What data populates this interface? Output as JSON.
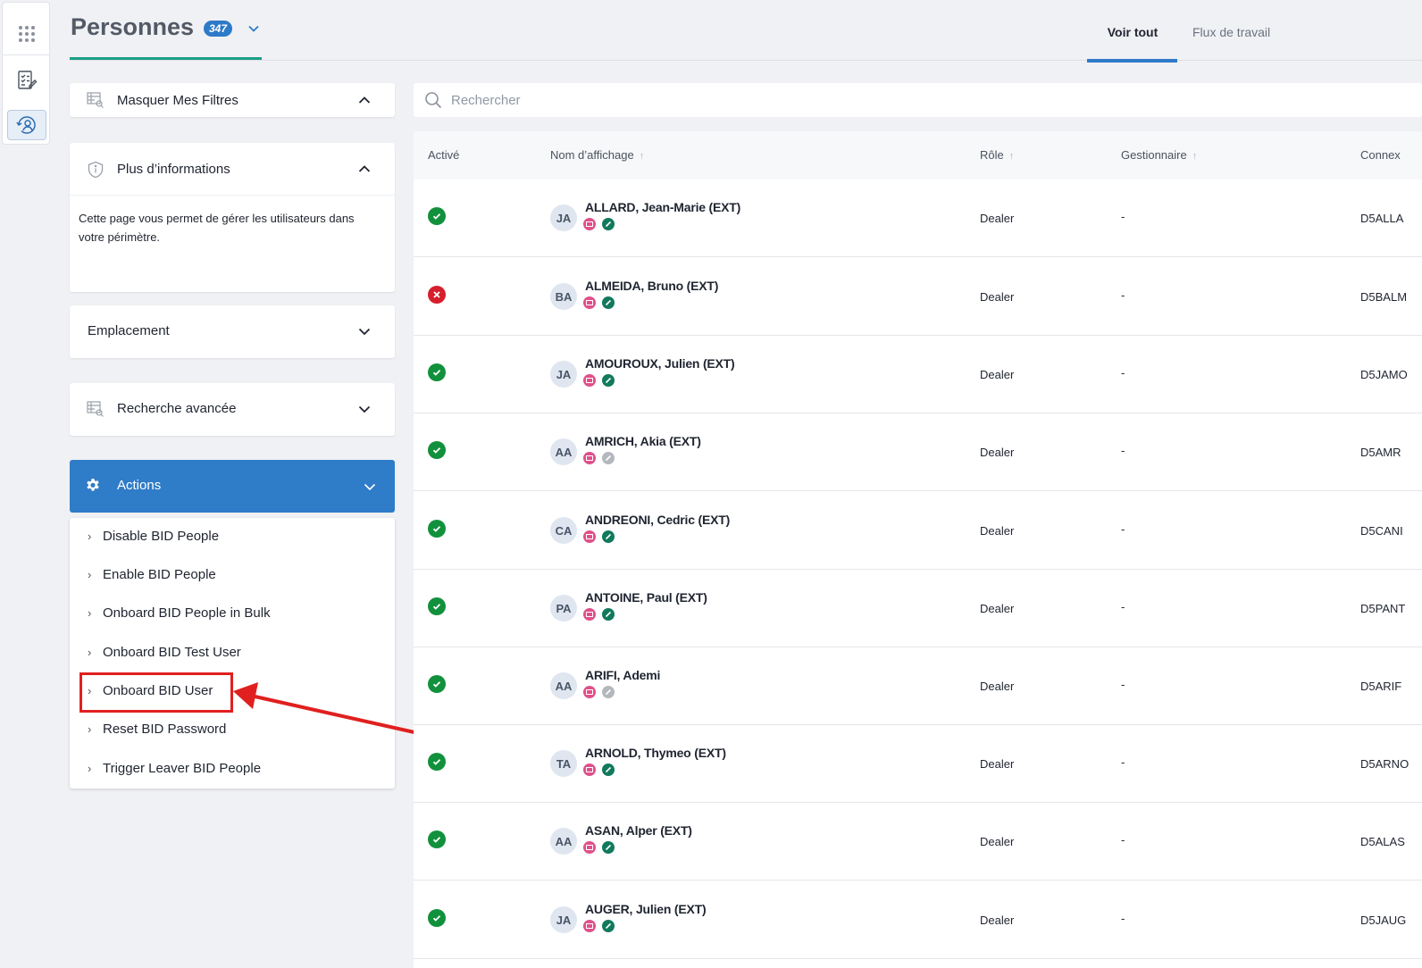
{
  "header": {
    "title": "Personnes",
    "count": "347",
    "tabs": [
      {
        "label": "Voir tout",
        "active": true
      },
      {
        "label": "Flux de travail",
        "active": false
      }
    ]
  },
  "rail": {
    "icons": [
      "apps-grid-icon",
      "tasks-icon",
      "people-history-icon"
    ]
  },
  "filters": {
    "hide_label": "Masquer Mes Filtres",
    "info_title": "Plus d’informations",
    "info_text": "Cette page vous permet de gérer les utilisateurs dans votre périmètre.",
    "location_title": "Emplacement",
    "advanced_title": "Recherche avancée"
  },
  "actions": {
    "title": "Actions",
    "items": [
      "Disable BID People",
      "Enable BID People",
      "Onboard BID People in Bulk",
      "Onboard BID Test User",
      "Onboard BID User",
      "Reset BID Password",
      "Trigger Leaver BID People"
    ],
    "highlighted": "Onboard BID User"
  },
  "search": {
    "placeholder": "Rechercher"
  },
  "table": {
    "columns": [
      "Activé",
      "Nom d’affichage",
      "Rôle",
      "Gestionnaire",
      "Connex"
    ],
    "rows": [
      {
        "active": true,
        "initials": "JA",
        "name": "ALLARD, Jean-Marie (EXT)",
        "phone_active": true,
        "role": "Dealer",
        "manager": "-",
        "login": "D5ALLA"
      },
      {
        "active": false,
        "initials": "BA",
        "name": "ALMEIDA, Bruno (EXT)",
        "phone_active": true,
        "role": "Dealer",
        "manager": "-",
        "login": "D5BALM"
      },
      {
        "active": true,
        "initials": "JA",
        "name": "AMOUROUX, Julien (EXT)",
        "phone_active": true,
        "role": "Dealer",
        "manager": "-",
        "login": "D5JAMO"
      },
      {
        "active": true,
        "initials": "AA",
        "name": "AMRICH, Akia (EXT)",
        "phone_active": false,
        "role": "Dealer",
        "manager": "-",
        "login": "D5AMR"
      },
      {
        "active": true,
        "initials": "CA",
        "name": "ANDREONI, Cedric (EXT)",
        "phone_active": true,
        "role": "Dealer",
        "manager": "-",
        "login": "D5CANI"
      },
      {
        "active": true,
        "initials": "PA",
        "name": "ANTOINE, Paul (EXT)",
        "phone_active": true,
        "role": "Dealer",
        "manager": "-",
        "login": "D5PANT"
      },
      {
        "active": true,
        "initials": "AA",
        "name": "ARIFI, Ademi",
        "phone_active": false,
        "role": "Dealer",
        "manager": "-",
        "login": "D5ARIF"
      },
      {
        "active": true,
        "initials": "TA",
        "name": "ARNOLD, Thymeo (EXT)",
        "phone_active": true,
        "role": "Dealer",
        "manager": "-",
        "login": "D5ARNO"
      },
      {
        "active": true,
        "initials": "AA",
        "name": "ASAN, Alper (EXT)",
        "phone_active": true,
        "role": "Dealer",
        "manager": "-",
        "login": "D5ALAS"
      },
      {
        "active": true,
        "initials": "JA",
        "name": "AUGER, Julien (EXT)",
        "phone_active": true,
        "role": "Dealer",
        "manager": "-",
        "login": "D5JAUG"
      }
    ]
  },
  "colors": {
    "accent": "#2f7cc8",
    "teal_underline": "#1b9e88",
    "active_green": "#12913d",
    "inactive_red": "#d61f2c",
    "annotation_red": "#e0201f"
  }
}
